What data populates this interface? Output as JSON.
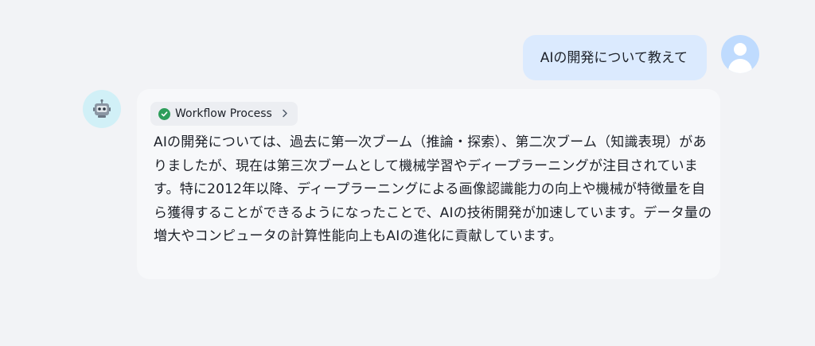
{
  "user_message": {
    "text": "AIの開発について教えて"
  },
  "bot_message": {
    "workflow_label": "Workflow Process",
    "status_color": "#2e9e5b",
    "answer": "AIの開発については、過去に第一次ブーム（推論・探索）、第二次ブーム（知識表現）がありましたが、現在は第三次ブームとして機械学習やディープラーニングが注目されています。特に2012年以降、ディープラーニングによる画像認識能力の向上や機械が特徴量を自ら獲得することができるようになったことで、AIの技術開発が加速しています。データ量の増大やコンピュータの計算性能向上もAIの進化に貢献しています。"
  },
  "icons": {
    "user_avatar": "user-silhouette-icon",
    "bot_avatar": "robot-icon",
    "workflow_status": "check-circle-icon",
    "workflow_expand": "chevron-right-icon"
  }
}
